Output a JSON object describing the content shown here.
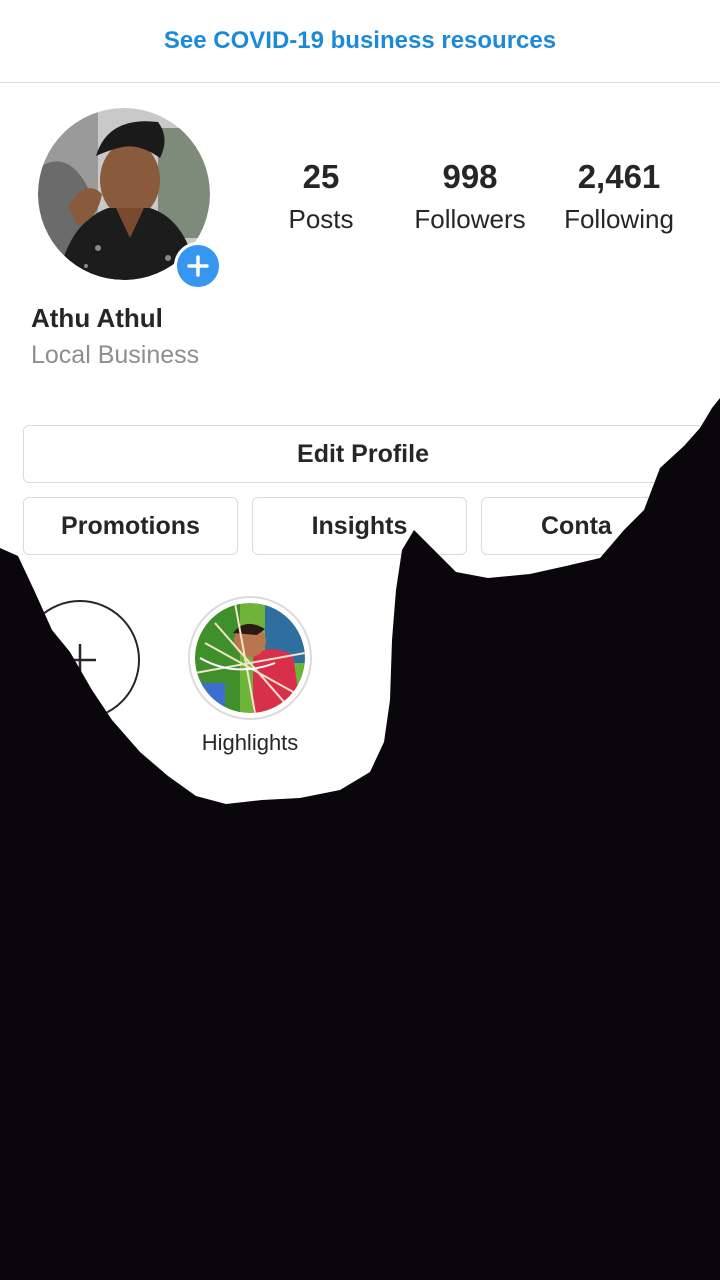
{
  "banner": {
    "covid_link": "See COVID-19 business resources"
  },
  "profile": {
    "name": "Athu Athul",
    "category": "Local Business",
    "stats": [
      {
        "value": "25",
        "label": "Posts"
      },
      {
        "value": "998",
        "label": "Followers"
      },
      {
        "value": "2,461",
        "label": "Following"
      }
    ]
  },
  "buttons": {
    "edit_profile": "Edit Profile",
    "promotions": "Promotions",
    "insights": "Insights",
    "contact": "Conta"
  },
  "highlights": {
    "items": [
      {
        "label": "Highlights"
      }
    ]
  },
  "colors": {
    "link_blue": "#1d8ad8",
    "badge_blue": "#3797f0",
    "text_dark": "#262626",
    "text_muted": "#8e8e8e",
    "overlay_black": "#0a070c"
  }
}
